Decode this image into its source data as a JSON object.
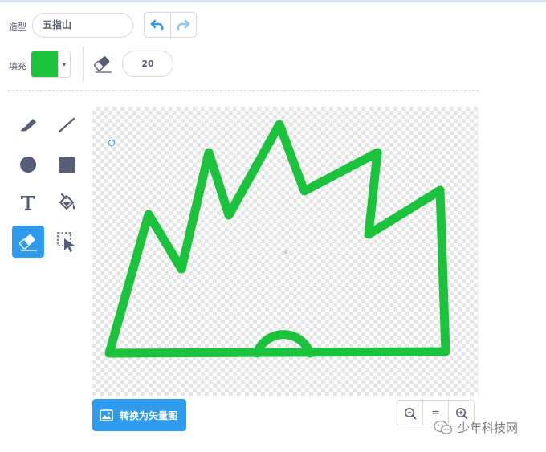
{
  "costume": {
    "label": "造型",
    "name_value": "五指山"
  },
  "toolbar": {
    "undo_icon": "undo-icon",
    "redo_icon": "redo-icon"
  },
  "fill": {
    "label": "填充",
    "color": "#1ac33b"
  },
  "brush": {
    "icon": "eraser-icon",
    "size_value": "20"
  },
  "tools": [
    {
      "icon": "brush-icon",
      "active": false
    },
    {
      "icon": "line-icon",
      "active": false
    },
    {
      "icon": "circle-icon",
      "active": false
    },
    {
      "icon": "rectangle-icon",
      "active": false
    },
    {
      "icon": "text-icon",
      "active": false
    },
    {
      "icon": "fill-bucket-icon",
      "active": false
    },
    {
      "icon": "eraser-icon",
      "active": true
    },
    {
      "icon": "select-icon",
      "active": false
    }
  ],
  "canvas": {
    "stroke_color": "#1ac33b",
    "accent": "#2f9bef"
  },
  "convert_button": {
    "label": "转换为矢量图"
  },
  "zoom": {
    "zoom_out": "−",
    "reset": "=",
    "zoom_in": "+"
  },
  "watermark": {
    "text": "少年科技网"
  }
}
